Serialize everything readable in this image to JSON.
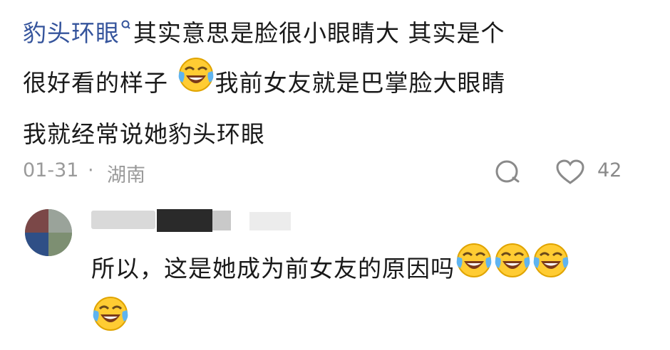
{
  "comment": {
    "highlight": "豹头环眼",
    "text_line1_rest": "其实意思是脸很小眼睛大 其实是个",
    "text_line2_a": "很好看的样子",
    "text_line2_b": "我前女友就是巴掌脸大眼睛",
    "text_line3": "我就经常说她豹头环眼",
    "date": "01-31",
    "separator": "·",
    "location": "湖南",
    "like_count": "42",
    "emoji": "face-with-tears-of-joy",
    "icons": {
      "search": "search-icon",
      "reply": "reply-bubble-icon",
      "like": "heart-icon"
    }
  },
  "reply": {
    "text": "所以，这是她成为前女友的原因吗",
    "emoji": "face-with-tears-of-joy",
    "emoji_count": 4
  },
  "colors": {
    "link": "#35549c",
    "meta": "#9a9a9a",
    "text": "#1a1a1a"
  }
}
